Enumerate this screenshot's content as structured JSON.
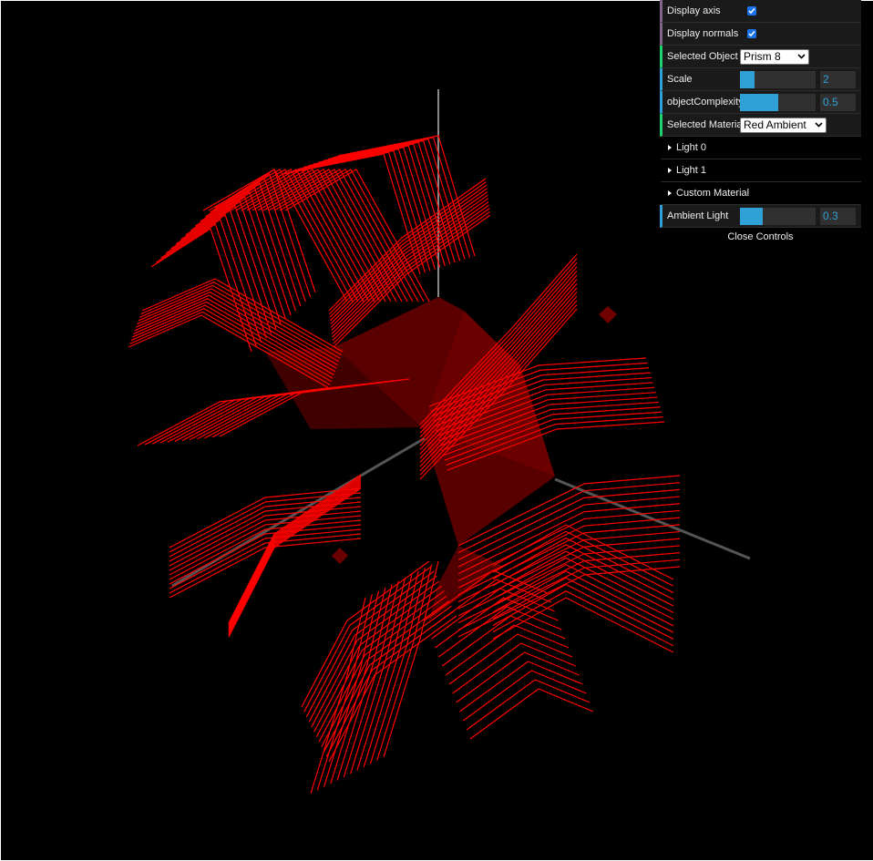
{
  "scene": {
    "description_free": true,
    "material_color": "#ff0000",
    "face_color": "#5a0000",
    "axis_color": "#555555"
  },
  "controls": {
    "display_axis": {
      "label": "Display axis",
      "checked": true
    },
    "display_normals": {
      "label": "Display normals",
      "checked": true
    },
    "selected_object": {
      "label": "Selected Object",
      "value": "Prism 8"
    },
    "scale": {
      "label": "Scale",
      "value": "2",
      "fill_fraction": 0.19
    },
    "object_complexity": {
      "label": "objectComplexity",
      "value": "0.5",
      "fill_fraction": 0.5
    },
    "selected_material": {
      "label": "Selected Material",
      "value": "Red Ambient"
    },
    "folders": [
      "Light 0",
      "Light 1",
      "Custom Material"
    ],
    "ambient_light": {
      "label": "Ambient Light",
      "value": "0.3",
      "fill_fraction": 0.3
    },
    "close_label": "Close Controls"
  }
}
